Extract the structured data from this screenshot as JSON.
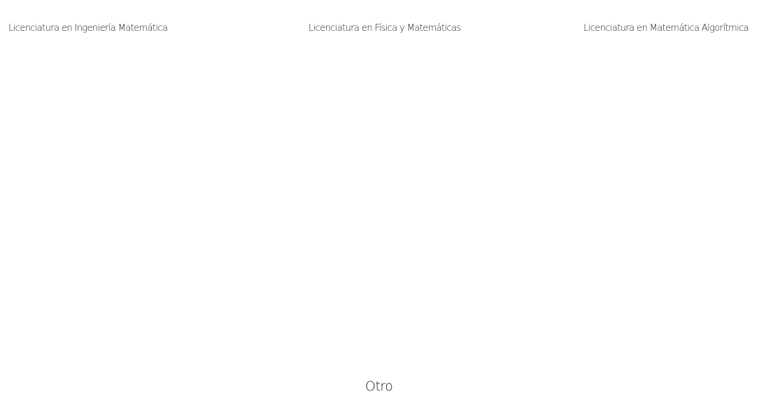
{
  "options": [
    {
      "label": "Licenciatura en Ingeniería Matemática"
    },
    {
      "label": "Licenciatura en Física y Matemáticas"
    },
    {
      "label": "Licenciatura en Matemática Algorítmica"
    }
  ],
  "other": {
    "label": "Otro"
  }
}
